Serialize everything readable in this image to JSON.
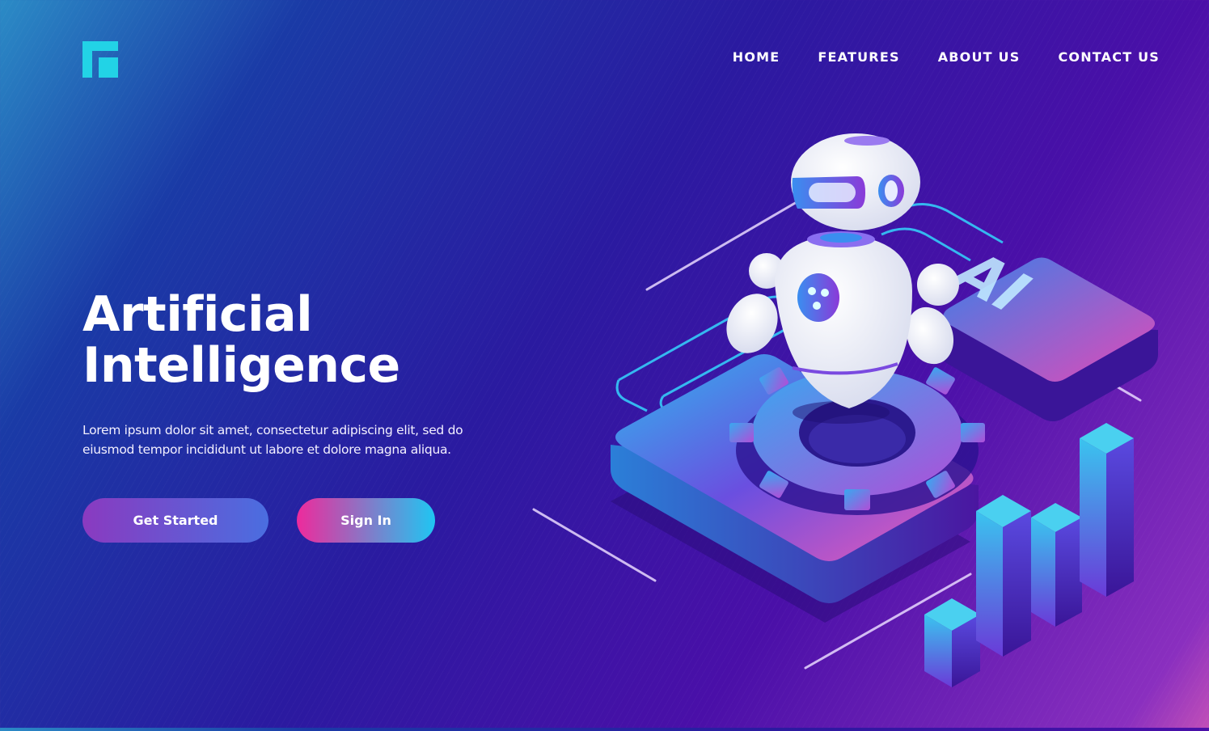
{
  "header": {
    "logo_icon": "brand-logo-icon",
    "nav": [
      {
        "label": "HOME"
      },
      {
        "label": "FEATURES"
      },
      {
        "label": "ABOUT US"
      },
      {
        "label": "CONTACT US"
      }
    ]
  },
  "hero": {
    "title_line1": "Artificial",
    "title_line2": "Intelligence",
    "description": "Lorem ipsum dolor sit amet, consectetur adipiscing elit, sed do eiusmod tempor incididunt ut labore et dolore magna aliqua.",
    "primary_button": "Get Started",
    "secondary_button": "Sign In"
  },
  "illustration": {
    "ai_tile_text": "AI",
    "icons": [
      "robot-icon",
      "gear-icon",
      "bar-chart-icon"
    ]
  },
  "colors": {
    "accent_cyan": "#22d3e6",
    "accent_pink": "#ee2a9c",
    "accent_purple": "#8a3ac0"
  }
}
